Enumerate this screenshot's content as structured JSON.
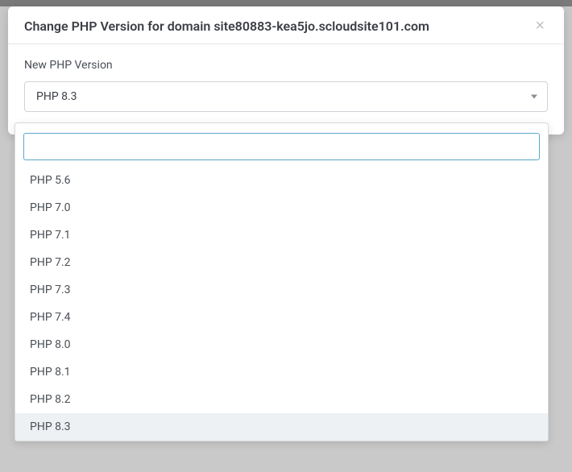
{
  "modal": {
    "title": "Change PHP Version for domain site80883-kea5jo.scloudsite101.com",
    "close_glyph": "×"
  },
  "field": {
    "label": "New PHP Version",
    "selected": "PHP 8.3"
  },
  "dropdown": {
    "search_value": "",
    "options": [
      "PHP 5.6",
      "PHP 7.0",
      "PHP 7.1",
      "PHP 7.2",
      "PHP 7.3",
      "PHP 7.4",
      "PHP 8.0",
      "PHP 8.1",
      "PHP 8.2",
      "PHP 8.3"
    ],
    "highlighted_index": 9
  }
}
